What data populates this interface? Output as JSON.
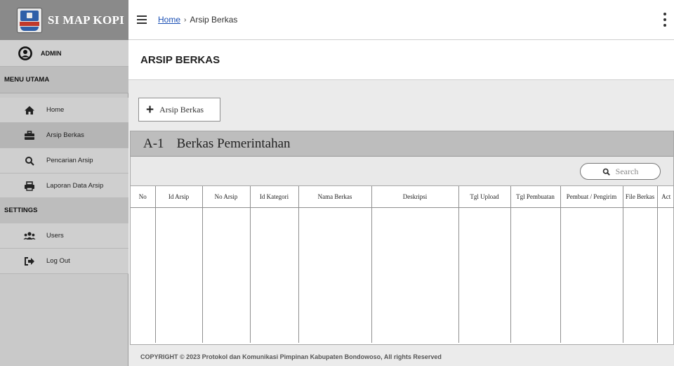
{
  "app": {
    "title": "SI MAP KOPI"
  },
  "user": {
    "name": "ADMIN"
  },
  "sidebar": {
    "menu_title": "MENU UTAMA",
    "items": [
      {
        "label": "Home",
        "icon": "home-icon"
      },
      {
        "label": "Arsip Berkas",
        "icon": "briefcase-icon"
      },
      {
        "label": "Pencarian Arsip",
        "icon": "search-icon"
      },
      {
        "label": "Laporan Data Arsip",
        "icon": "printer-icon"
      }
    ],
    "settings_title": "SETTINGS",
    "settings_items": [
      {
        "label": "Users",
        "icon": "users-icon"
      },
      {
        "label": "Log Out",
        "icon": "logout-icon"
      }
    ]
  },
  "breadcrumb": {
    "home": "Home",
    "separator": "›",
    "current": "Arsip Berkas"
  },
  "page": {
    "title": "ARSIP BERKAS"
  },
  "add_button": {
    "label": "Arsip Berkas"
  },
  "panel": {
    "code": "A-1",
    "name": "Berkas Pemerintahan"
  },
  "search": {
    "placeholder": "Search"
  },
  "table": {
    "columns": [
      "No",
      "Id Arsip",
      "No Arsip",
      "Id Kategori",
      "Nama Berkas",
      "Deskripsi",
      "Tgl Upload",
      "Tgl Pembuatan",
      "Pembuat / Pengirim",
      "File Berkas",
      "Act"
    ]
  },
  "footer": {
    "text": "COPYRIGHT © 2023 Protokol dan Komunikasi Pimpinan Kabupaten Bondowoso, All rights Reserved"
  },
  "colors": {
    "sidebar": "#c9c9c9",
    "brand_bar": "#8a8a8a",
    "active_item": "#b5b5b5",
    "link": "#1a4fb4",
    "panel_header": "#bdbdbd"
  }
}
